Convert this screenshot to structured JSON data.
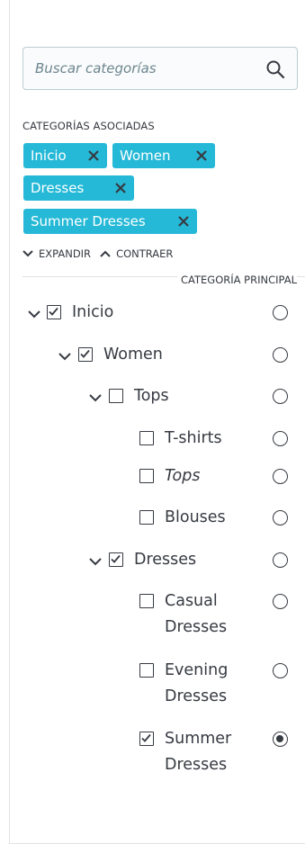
{
  "search": {
    "placeholder": "Buscar categorías"
  },
  "associated": {
    "title": "CATEGORÍAS ASOCIADAS",
    "tags": [
      "Inicio",
      "Women",
      "Dresses",
      "Summer Dresses"
    ]
  },
  "controls": {
    "expand": "EXPANDIR",
    "collapse": "CONTRAER"
  },
  "tree": {
    "main_header": "CATEGORÍA PRINCIPAL",
    "items": [
      {
        "label": "Inicio",
        "checked": true,
        "expanded": true,
        "main": false
      },
      {
        "label": "Women",
        "checked": true,
        "expanded": true,
        "main": false
      },
      {
        "label": "Tops",
        "checked": false,
        "expanded": true,
        "main": false
      },
      {
        "label": "T-shirts",
        "checked": false,
        "main": false
      },
      {
        "label": "Tops",
        "checked": false,
        "main": false
      },
      {
        "label": "Blouses",
        "checked": false,
        "main": false
      },
      {
        "label": "Dresses",
        "checked": true,
        "expanded": true,
        "main": false
      },
      {
        "label_lines": [
          "Casual",
          "Dresses"
        ],
        "checked": false,
        "main": false
      },
      {
        "label_lines": [
          "Evening",
          "Dresses"
        ],
        "checked": false,
        "main": false
      },
      {
        "label_lines": [
          "Summer",
          "Dresses"
        ],
        "checked": true,
        "main": true
      }
    ]
  },
  "colors": {
    "accent": "#25b9d7",
    "text": "#363a41",
    "border": "#bbcdd2"
  }
}
